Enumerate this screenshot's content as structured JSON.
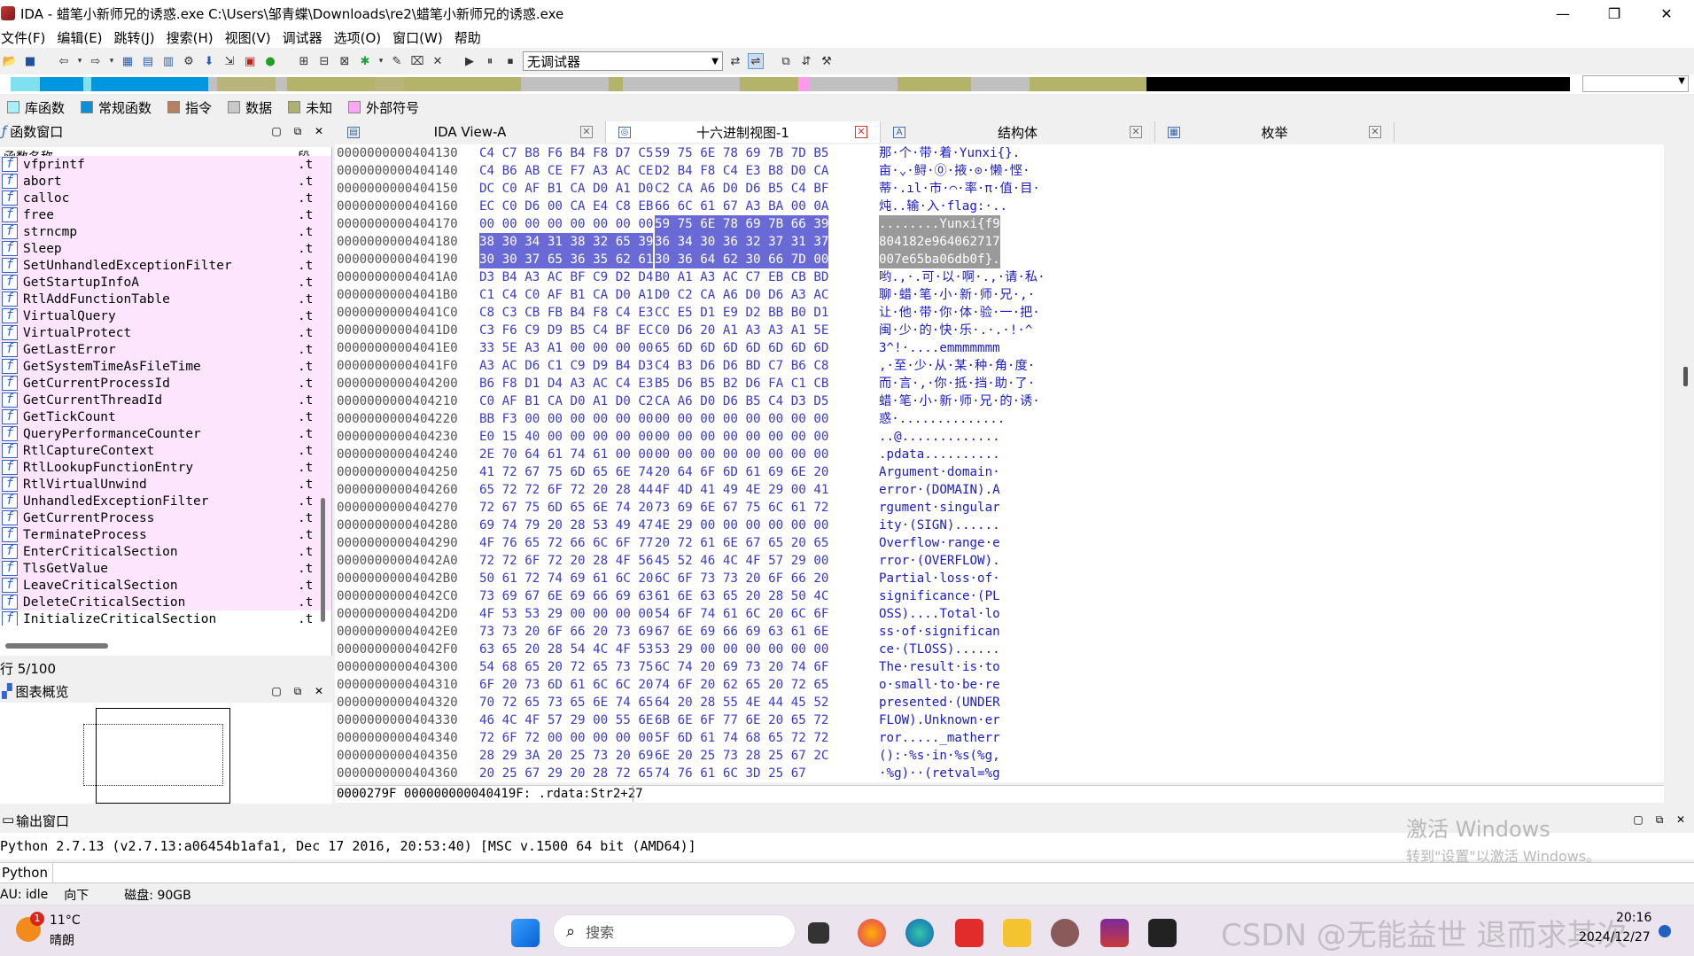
{
  "window": {
    "title": "IDA - 蜡笔小新师兄的诱惑.exe C:\\Users\\邹青蝶\\Downloads\\re2\\蜡笔小新师兄的诱惑.exe",
    "minimize": "—",
    "maximize": "❐",
    "close": "✕"
  },
  "menu": [
    "文件(F)",
    "编辑(E)",
    "跳转(J)",
    "搜索(H)",
    "视图(V)",
    "调试器",
    "选项(O)",
    "窗口(W)",
    "帮助"
  ],
  "toolbar": {
    "debugger": "无调试器"
  },
  "navband": {
    "colors": {
      "lib": "#7fe0f0",
      "regular": "#0096e0",
      "code": "#b9b57a",
      "data": "#c0c0c0",
      "unknown": "#b3b36a",
      "external": "#ff9af0",
      "black": "#000000"
    },
    "segments": [
      [
        "lib",
        2
      ],
      [
        "regular",
        3
      ],
      [
        "lib",
        0.5
      ],
      [
        "regular",
        8
      ],
      [
        "data",
        0.6
      ],
      [
        "code",
        4
      ],
      [
        "data",
        0.8
      ],
      [
        "unknown",
        6
      ],
      [
        "code",
        2
      ],
      [
        "unknown",
        8
      ],
      [
        "data",
        6
      ],
      [
        "unknown",
        1
      ],
      [
        "data",
        8
      ],
      [
        "unknown",
        4
      ],
      [
        "external",
        0.8
      ],
      [
        "data",
        6
      ],
      [
        "unknown",
        5
      ],
      [
        "data",
        4
      ],
      [
        "unknown",
        8
      ],
      [
        "black",
        29
      ]
    ]
  },
  "legend": [
    {
      "label": "库函数",
      "color": "#a8f0f8"
    },
    {
      "label": "常规函数",
      "color": "#0f8fd8"
    },
    {
      "label": "指令",
      "color": "#b88060"
    },
    {
      "label": "数据",
      "color": "#c8c8c8"
    },
    {
      "label": "未知",
      "color": "#b0b070"
    },
    {
      "label": "外部符号",
      "color": "#ffa8f8"
    }
  ],
  "functions_pane": {
    "title": "函数窗口",
    "col_name": "函数名称",
    "col_seg": "段",
    "rows": [
      [
        "vfprintf",
        ".t"
      ],
      [
        "abort",
        ".t"
      ],
      [
        "calloc",
        ".t"
      ],
      [
        "free",
        ".t"
      ],
      [
        "strncmp",
        ".t"
      ],
      [
        "Sleep",
        ".t"
      ],
      [
        "SetUnhandledExceptionFilter",
        ".t"
      ],
      [
        "GetStartupInfoA",
        ".t"
      ],
      [
        "RtlAddFunctionTable",
        ".t"
      ],
      [
        "VirtualQuery",
        ".t"
      ],
      [
        "VirtualProtect",
        ".t"
      ],
      [
        "GetLastError",
        ".t"
      ],
      [
        "GetSystemTimeAsFileTime",
        ".t"
      ],
      [
        "GetCurrentProcessId",
        ".t"
      ],
      [
        "GetCurrentThreadId",
        ".t"
      ],
      [
        "GetTickCount",
        ".t"
      ],
      [
        "QueryPerformanceCounter",
        ".t"
      ],
      [
        "RtlCaptureContext",
        ".t"
      ],
      [
        "RtlLookupFunctionEntry",
        ".t"
      ],
      [
        "RtlVirtualUnwind",
        ".t"
      ],
      [
        "UnhandledExceptionFilter",
        ".t"
      ],
      [
        "GetCurrentProcess",
        ".t"
      ],
      [
        "TerminateProcess",
        ".t"
      ],
      [
        "EnterCriticalSection",
        ".t"
      ],
      [
        "TlsGetValue",
        ".t"
      ],
      [
        "LeaveCriticalSection",
        ".t"
      ],
      [
        "DeleteCriticalSection",
        ".t"
      ],
      [
        "InitializeCriticalSection",
        ".t"
      ]
    ],
    "row_info": "行 5/100"
  },
  "graph_pane": {
    "title": "图表概览"
  },
  "tabs": [
    {
      "label": "IDA View-A"
    },
    {
      "label": "十六进制视图-1"
    },
    {
      "label": "结构体"
    },
    {
      "label": "枚举"
    }
  ],
  "hex_rows": [
    {
      "addr": "0000000000404130",
      "b1": "C4 C7 B8 F6 B4 F8 D7 C5",
      "b2": "59 75 6E 78 69 7B 7D B5",
      "ascii": "那·个·带·着·Yunxi{}."
    },
    {
      "addr": "0000000000404140",
      "b1": "C4 B6 AB CE F7 A3 AC CE",
      "b2": "D2 B4 F8 C4 E3 B8 D0 CA",
      "ascii": "亩·⌄·鲟·🄋·掖·⊙·懒·悭·"
    },
    {
      "addr": "0000000000404150",
      "b1": "DC C0 AF B1 CA D0 A1 D0",
      "b2": "C2 CA A6 D0 D6 B5 C4 BF",
      "ascii": "蒂·.ıl·市·⌒·率·π·值·目·"
    },
    {
      "addr": "0000000000404160",
      "b1": "EC C0 D6 00 CA E4 C8 EB",
      "b2": "66 6C 61 67 A3 BA 00 0A",
      "ascii": "炖..输·入·flag:·.."
    },
    {
      "addr": "0000000000404170",
      "b1": "00 00 00 00 00 00 00 00",
      "b2": "59 75 6E 78 69 7B 66 39",
      "ascii": "........Yunxi{f9",
      "sel2": true,
      "asel": true
    },
    {
      "addr": "0000000000404180",
      "b1": "38 30 34 31 38 32 65 39",
      "b2": "36 34 30 36 32 37 31 37",
      "ascii": "804182e964062717",
      "sel1": true,
      "sel2": true,
      "asel": true
    },
    {
      "addr": "0000000000404190",
      "b1": "30 30 37 65 36 35 62 61",
      "b2": "30 36 64 62 30 66 7D 00",
      "ascii": "007e65ba06db0f}.",
      "sel1": true,
      "sel2": true,
      "asel": true
    },
    {
      "addr": "00000000004041A0",
      "b1": "D3 B4 A3 AC BF C9 D2 D4",
      "b2": "B0 A1 A3 AC C7 EB CB BD",
      "ascii": "哟.,·.可·以·啊·.,·请·私·"
    },
    {
      "addr": "00000000004041B0",
      "b1": "C1 C4 C0 AF B1 CA D0 A1",
      "b2": "D0 C2 CA A6 D0 D6 A3 AC",
      "ascii": "聊·蜡·笔·小·新·师·兄·,·"
    },
    {
      "addr": "00000000004041C0",
      "b1": "C8 C3 CB FB B4 F8 C4 E3",
      "b2": "CC E5 D1 E9 D2 BB B0 D1",
      "ascii": "让·他·带·你·体·验·一·把·"
    },
    {
      "addr": "00000000004041D0",
      "b1": "C3 F6 C9 D9 B5 C4 BF EC",
      "b2": "C0 D6 20 A1 A3 A3 A1 5E",
      "ascii": "闽·少·的·快·乐·.·.·!·^"
    },
    {
      "addr": "00000000004041E0",
      "b1": "33 5E A3 A1 00 00 00 00",
      "b2": "65 6D 6D 6D 6D 6D 6D 6D",
      "ascii": "3^!·....emmmmmmm"
    },
    {
      "addr": "00000000004041F0",
      "b1": "A3 AC D6 C1 C9 D9 B4 D3",
      "b2": "C4 B3 D6 D6 BD C7 B6 C8",
      "ascii": ",·至·少·从·某·种·角·度·"
    },
    {
      "addr": "0000000000404200",
      "b1": "B6 F8 D1 D4 A3 AC C4 E3",
      "b2": "B5 D6 B5 B2 D6 FA C1 CB",
      "ascii": "而·言·,·你·抵·挡·助·了·"
    },
    {
      "addr": "0000000000404210",
      "b1": "C0 AF B1 CA D0 A1 D0 C2",
      "b2": "CA A6 D0 D6 B5 C4 D3 D5",
      "ascii": "蜡·笔·小·新·师·兄·的·诱·"
    },
    {
      "addr": "0000000000404220",
      "b1": "BB F3 00 00 00 00 00 00",
      "b2": "00 00 00 00 00 00 00 00",
      "ascii": "惑·.............."
    },
    {
      "addr": "0000000000404230",
      "b1": "E0 15 40 00 00 00 00 00",
      "b2": "00 00 00 00 00 00 00 00",
      "ascii": "..@............."
    },
    {
      "addr": "0000000000404240",
      "b1": "2E 70 64 61 74 61 00 00",
      "b2": "00 00 00 00 00 00 00 00",
      "ascii": ".pdata.........."
    },
    {
      "addr": "0000000000404250",
      "b1": "41 72 67 75 6D 65 6E 74",
      "b2": "20 64 6F 6D 61 69 6E 20",
      "ascii": "Argument·domain·"
    },
    {
      "addr": "0000000000404260",
      "b1": "65 72 72 6F 72 20 28 44",
      "b2": "4F 4D 41 49 4E 29 00 41",
      "ascii": "error·(DOMAIN).A"
    },
    {
      "addr": "0000000000404270",
      "b1": "72 67 75 6D 65 6E 74 20",
      "b2": "73 69 6E 67 75 6C 61 72",
      "ascii": "rgument·singular"
    },
    {
      "addr": "0000000000404280",
      "b1": "69 74 79 20 28 53 49 47",
      "b2": "4E 29 00 00 00 00 00 00",
      "ascii": "ity·(SIGN)......"
    },
    {
      "addr": "0000000000404290",
      "b1": "4F 76 65 72 66 6C 6F 77",
      "b2": "20 72 61 6E 67 65 20 65",
      "ascii": "Overflow·range·e"
    },
    {
      "addr": "00000000004042A0",
      "b1": "72 72 6F 72 20 28 4F 56",
      "b2": "45 52 46 4C 4F 57 29 00",
      "ascii": "rror·(OVERFLOW)."
    },
    {
      "addr": "00000000004042B0",
      "b1": "50 61 72 74 69 61 6C 20",
      "b2": "6C 6F 73 73 20 6F 66 20",
      "ascii": "Partial·loss·of·"
    },
    {
      "addr": "00000000004042C0",
      "b1": "73 69 67 6E 69 66 69 63",
      "b2": "61 6E 63 65 20 28 50 4C",
      "ascii": "significance·(PL"
    },
    {
      "addr": "00000000004042D0",
      "b1": "4F 53 53 29 00 00 00 00",
      "b2": "54 6F 74 61 6C 20 6C 6F",
      "ascii": "OSS)....Total·lo"
    },
    {
      "addr": "00000000004042E0",
      "b1": "73 73 20 6F 66 20 73 69",
      "b2": "67 6E 69 66 69 63 61 6E",
      "ascii": "ss·of·significan"
    },
    {
      "addr": "00000000004042F0",
      "b1": "63 65 20 28 54 4C 4F 53",
      "b2": "53 29 00 00 00 00 00 00",
      "ascii": "ce·(TLOSS)......"
    },
    {
      "addr": "0000000000404300",
      "b1": "54 68 65 20 72 65 73 75",
      "b2": "6C 74 20 69 73 20 74 6F",
      "ascii": "The·result·is·to"
    },
    {
      "addr": "0000000000404310",
      "b1": "6F 20 73 6D 61 6C 6C 20",
      "b2": "74 6F 20 62 65 20 72 65",
      "ascii": "o·small·to·be·re"
    },
    {
      "addr": "0000000000404320",
      "b1": "70 72 65 73 65 6E 74 65",
      "b2": "64 20 28 55 4E 44 45 52",
      "ascii": "presented·(UNDER"
    },
    {
      "addr": "0000000000404330",
      "b1": "46 4C 4F 57 29 00 55 6E",
      "b2": "6B 6E 6F 77 6E 20 65 72",
      "ascii": "FLOW).Unknown·er"
    },
    {
      "addr": "0000000000404340",
      "b1": "72 6F 72 00 00 00 00 00",
      "b2": "5F 6D 61 74 68 65 72 72",
      "ascii": "ror....._matherr"
    },
    {
      "addr": "0000000000404350",
      "b1": "28 29 3A 20 25 73 20 69",
      "b2": "6E 20 25 73 28 25 67 2C",
      "ascii": "():·%s·in·%s(%g,"
    },
    {
      "addr": "0000000000404360",
      "b1": "20 25 67 29 20 28 72 65",
      "b2": "74 76 61 6C 3D 25 67",
      "ascii": "·%g)··(retval=%g"
    }
  ],
  "hex_status": "0000279F 000000000040419F: .rdata:Str2+27",
  "output": {
    "title": "输出窗口",
    "text": "Python 2.7.13 (v2.7.13:a06454b1afa1, Dec 17 2016, 20:53:40) [MSC v.1500 64 bit (AMD64)]",
    "prompt_label": "Python"
  },
  "statusbar": {
    "au": "AU:  idle",
    "direction": "向下",
    "disk": "磁盘: 90GB"
  },
  "watermark": {
    "line1": "激活 Windows",
    "line2": "转到\"设置\"以激活 Windows。"
  },
  "taskbar": {
    "weather_temp": "11°C",
    "weather_desc": "晴朗",
    "weather_badge": "1",
    "search_placeholder": "搜索",
    "time": "20:16",
    "date": "2024/12/27",
    "csdn": "CSDN @无能益世 退而求其次"
  }
}
